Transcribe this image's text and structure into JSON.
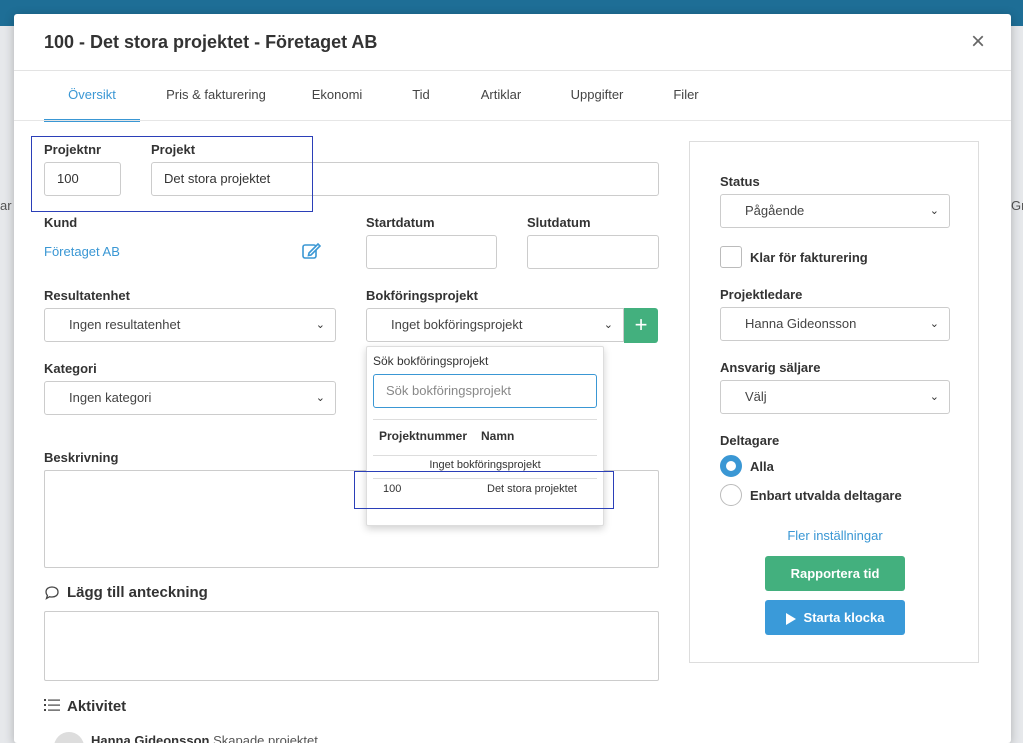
{
  "modal": {
    "title": "100 - Det stora projektet - Företaget AB",
    "close": "×"
  },
  "tabs": [
    "Översikt",
    "Pris & fakturering",
    "Ekonomi",
    "Tid",
    "Artiklar",
    "Uppgifter",
    "Filer"
  ],
  "form": {
    "projektnr_label": "Projektnr",
    "projektnr_value": "100",
    "projekt_label": "Projekt",
    "projekt_value": "Det stora projektet",
    "kund_label": "Kund",
    "kund_value": "Företaget AB",
    "startdatum_label": "Startdatum",
    "slutdatum_label": "Slutdatum",
    "resultatenhet_label": "Resultatenhet",
    "resultatenhet_value": "Ingen resultatenhet",
    "bokforing_label": "Bokföringsprojekt",
    "bokforing_value": "Inget bokföringsprojekt",
    "kategori_label": "Kategori",
    "kategori_value": "Ingen kategori",
    "beskrivning_label": "Beskrivning",
    "anteckning_label": "Lägg till anteckning",
    "aktivitet_label": "Aktivitet",
    "activity_user": "Hanna Gideonsson",
    "activity_text": "Skapade projektet"
  },
  "dropdown": {
    "header": "Sök bokföringsprojekt",
    "search_placeholder": "Sök bokföringsprojekt",
    "col_number": "Projektnummer",
    "col_name": "Namn",
    "option_none": "Inget bokföringsprojekt",
    "rows": [
      {
        "number": "100",
        "name": "Det stora projektet"
      }
    ]
  },
  "side_panel": {
    "status_label": "Status",
    "status_value": "Pågående",
    "klar_label": "Klar för fakturering",
    "projektledare_label": "Projektledare",
    "projektledare_value": "Hanna Gideonsson",
    "saljare_label": "Ansvarig säljare",
    "saljare_value": "Välj",
    "deltagare_label": "Deltagare",
    "deltagare_all": "Alla",
    "deltagare_selected": "Enbart utvalda deltagare",
    "more_settings": "Fler inställningar",
    "report_time": "Rapportera tid",
    "start_clock": "Starta klocka"
  },
  "background": {
    "left_fragment": "ar",
    "right_fragment": "Gr"
  },
  "colors": {
    "accent": "#3a97d4",
    "green": "#43b07e",
    "highlight": "#2b3fb8"
  }
}
